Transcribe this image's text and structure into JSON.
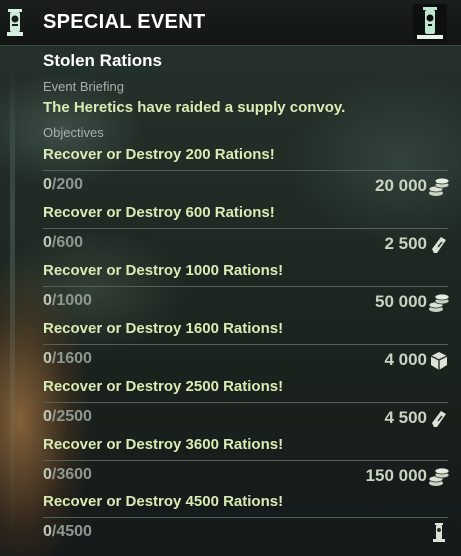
{
  "header": {
    "title": "SPECIAL EVENT",
    "left_icon": "skull-banner-icon",
    "right_icon": "skull-pillar-icon"
  },
  "event": {
    "name": "Stolen Rations",
    "briefing_label": "Event Briefing",
    "briefing": "The Heretics have raided a supply convoy.",
    "objectives_label": "Objectives"
  },
  "objectives": [
    {
      "title": "Recover or Destroy 200 Rations!",
      "current": "0",
      "total": "200",
      "reward": "20 000",
      "reward_icon": "coins-icon"
    },
    {
      "title": "Recover or Destroy 600 Rations!",
      "current": "0",
      "total": "600",
      "reward": "2 500",
      "reward_icon": "ticket-icon"
    },
    {
      "title": "Recover or Destroy 1000 Rations!",
      "current": "0",
      "total": "1000",
      "reward": "50 000",
      "reward_icon": "coins-icon"
    },
    {
      "title": "Recover or Destroy 1600 Rations!",
      "current": "0",
      "total": "1600",
      "reward": "4 000",
      "reward_icon": "cube-icon"
    },
    {
      "title": "Recover or Destroy 2500 Rations!",
      "current": "0",
      "total": "2500",
      "reward": "4 500",
      "reward_icon": "ticket-icon"
    },
    {
      "title": "Recover or Destroy 3600 Rations!",
      "current": "0",
      "total": "3600",
      "reward": "150 000",
      "reward_icon": "coins-icon"
    },
    {
      "title": "Recover or Destroy 4500 Rations!",
      "current": "0",
      "total": "4500",
      "reward": "",
      "reward_icon": "skull-pillar-icon"
    }
  ],
  "colors": {
    "accent_text": "#d9ecb4",
    "header_bg": "#111413",
    "icon_mint": "#bfe6cf"
  }
}
